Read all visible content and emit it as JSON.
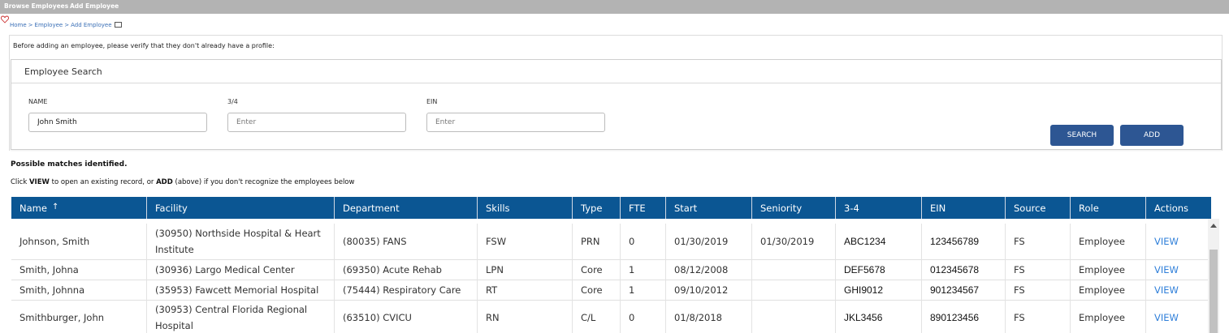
{
  "topnav": {
    "browse": "Browse Employees",
    "add": "Add Employee"
  },
  "breadcrumb": {
    "home": "Home",
    "employee": "Employee",
    "add_employee": "Add Employee",
    "separator": ">"
  },
  "verify_text": "Before adding an employee, please verify that they don't already have a profile:",
  "search": {
    "title": "Employee Search",
    "name_label": "NAME",
    "name_value": "John Smith",
    "three_four_label": "3/4",
    "three_four_placeholder": "Enter",
    "ein_label": "EIN",
    "ein_placeholder": "Enter",
    "search_button": "SEARCH",
    "add_button": "ADD"
  },
  "results": {
    "heading": "Possible matches identified.",
    "instr_pre": "Click ",
    "instr_view": "VIEW",
    "instr_mid": " to open an existing record, or ",
    "instr_add": "ADD",
    "instr_post": " (above) if you don't recognize the employees below",
    "sort_indicator": "↑",
    "columns": [
      "Name",
      "Facility",
      "Department",
      "Skills",
      "Type",
      "FTE",
      "Start",
      "Seniority",
      "3-4",
      "EIN",
      "Source",
      "Role",
      "Actions"
    ],
    "rows": [
      [
        "Johnson, Smith",
        "(30950) Northside Hospital & Heart Institute",
        "(80035) FANS",
        "FSW",
        "PRN",
        "0",
        "01/30/2019",
        "01/30/2019",
        "ABC1234",
        "123456789",
        "FS",
        "Employee",
        "VIEW"
      ],
      [
        "Smith, Johna",
        "(30936) Largo Medical Center",
        "(69350) Acute Rehab",
        "LPN",
        "Core",
        "1",
        "08/12/2008",
        "",
        "DEF5678",
        "012345678",
        "FS",
        "Employee",
        "VIEW"
      ],
      [
        "Smith, Johnna",
        "(35953) Fawcett Memorial Hospital",
        "(75444) Respiratory Care",
        "RT",
        "Core",
        "1",
        "09/10/2012",
        "",
        "GHI9012",
        "901234567",
        "FS",
        "Employee",
        "VIEW"
      ],
      [
        "Smithburger, John",
        "(30953) Central Florida Regional Hospital",
        "(63510) CVICU",
        "RN",
        "C/L",
        "0",
        "01/8/2018",
        "",
        "JKL3456",
        "890123456",
        "FS",
        "Employee",
        "VIEW"
      ]
    ]
  },
  "colors": {
    "topbar": "#b3b3b3",
    "header": "#0b5693",
    "button": "#2d5693",
    "link": "#2f7fd9"
  }
}
